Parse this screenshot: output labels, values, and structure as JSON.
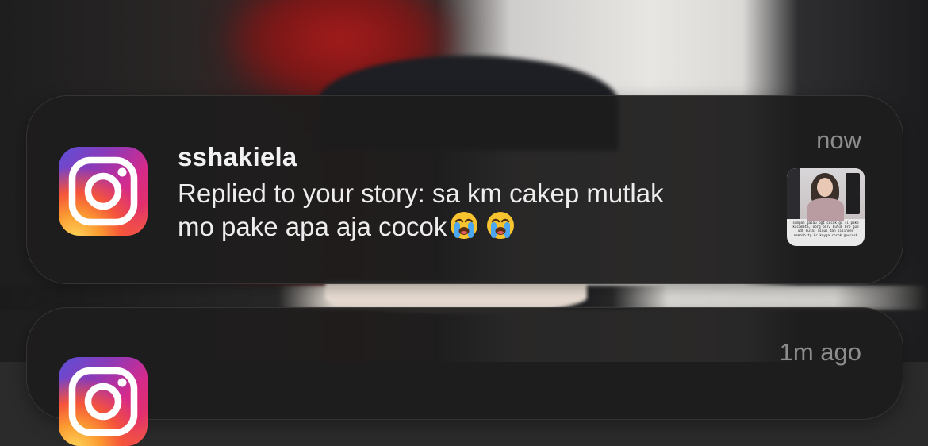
{
  "notifications": [
    {
      "app_icon": "instagram-icon",
      "username": "sshakiela",
      "message_line1": "Replied to your story: sa km cakep mutlak",
      "message_line2": "mo pake apa aja cocok",
      "emojis": [
        "loudly-crying-face",
        "loudly-crying-face"
      ],
      "timestamp": "now",
      "thumbnail_caption": "sumpah galau bgt cocok ga si pake kacamata, obrg bnr2 butuh bro gue udh mulai minus dan silinder nambah tp kc knyga cocok gaccosk"
    },
    {
      "app_icon": "instagram-icon",
      "timestamp": "1m ago"
    }
  ],
  "colors": {
    "card_bg": "#1e1d1d",
    "username": "#f2f2f2",
    "message": "#ededed",
    "timestamp": "#8d8d8d"
  }
}
